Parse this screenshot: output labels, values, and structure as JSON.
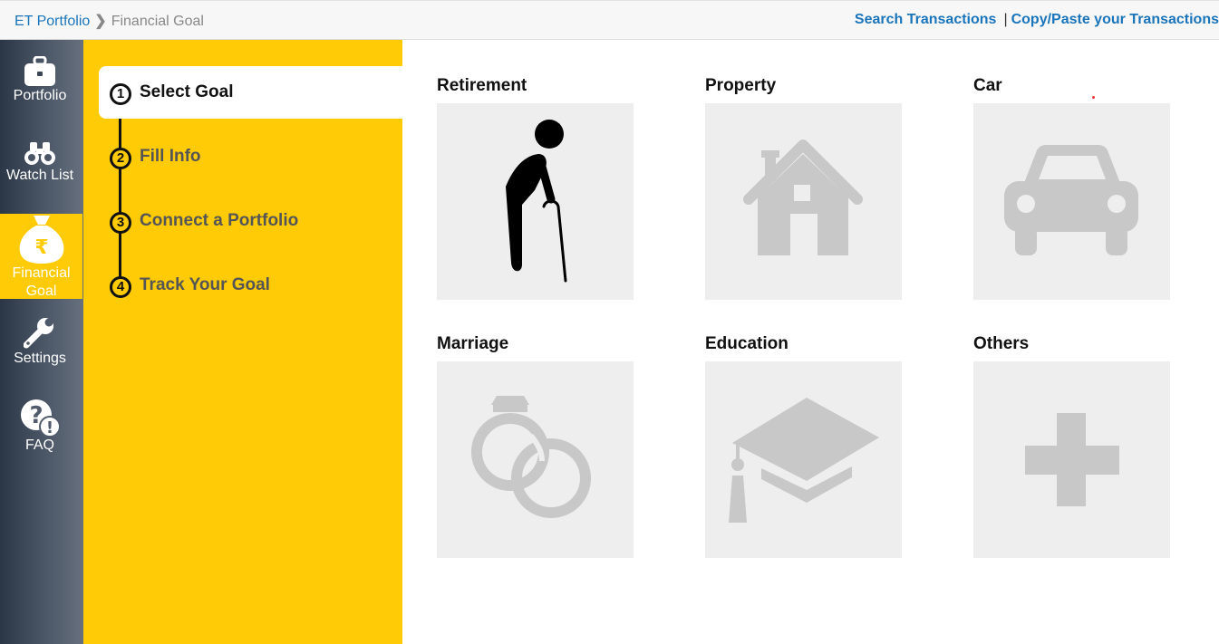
{
  "breadcrumb": {
    "home": "ET Portfolio",
    "current": "Financial Goal"
  },
  "toplinks": {
    "search": "Search Transactions",
    "separator": "|",
    "copy_paste": "Copy/Paste your Transactions"
  },
  "rail": {
    "items": [
      {
        "label": "Portfolio",
        "icon": "briefcase-icon"
      },
      {
        "label": "Watch List",
        "icon": "binoculars-icon"
      },
      {
        "label": "Financial Goal",
        "icon": "money-bag-icon",
        "active": true
      },
      {
        "label": "Settings",
        "icon": "wrench-icon"
      },
      {
        "label": "FAQ",
        "icon": "question-icon"
      }
    ]
  },
  "steps": [
    {
      "num": "1",
      "label": "Select Goal",
      "active": true
    },
    {
      "num": "2",
      "label": "Fill Info"
    },
    {
      "num": "3",
      "label": "Connect a Portfolio"
    },
    {
      "num": "4",
      "label": "Track Your Goal"
    }
  ],
  "goals": [
    {
      "label": "Retirement",
      "icon": "elderly-person-icon"
    },
    {
      "label": "Property",
      "icon": "house-icon"
    },
    {
      "label": "Car",
      "icon": "car-icon"
    },
    {
      "label": "Marriage",
      "icon": "rings-icon"
    },
    {
      "label": "Education",
      "icon": "graduation-cap-icon"
    },
    {
      "label": "Others",
      "icon": "plus-icon"
    }
  ],
  "colors": {
    "accent_yellow": "#fecb06",
    "link_blue": "#1b75bb",
    "tile_bg": "#eeeeee",
    "icon_grey": "#c8c8c8"
  }
}
